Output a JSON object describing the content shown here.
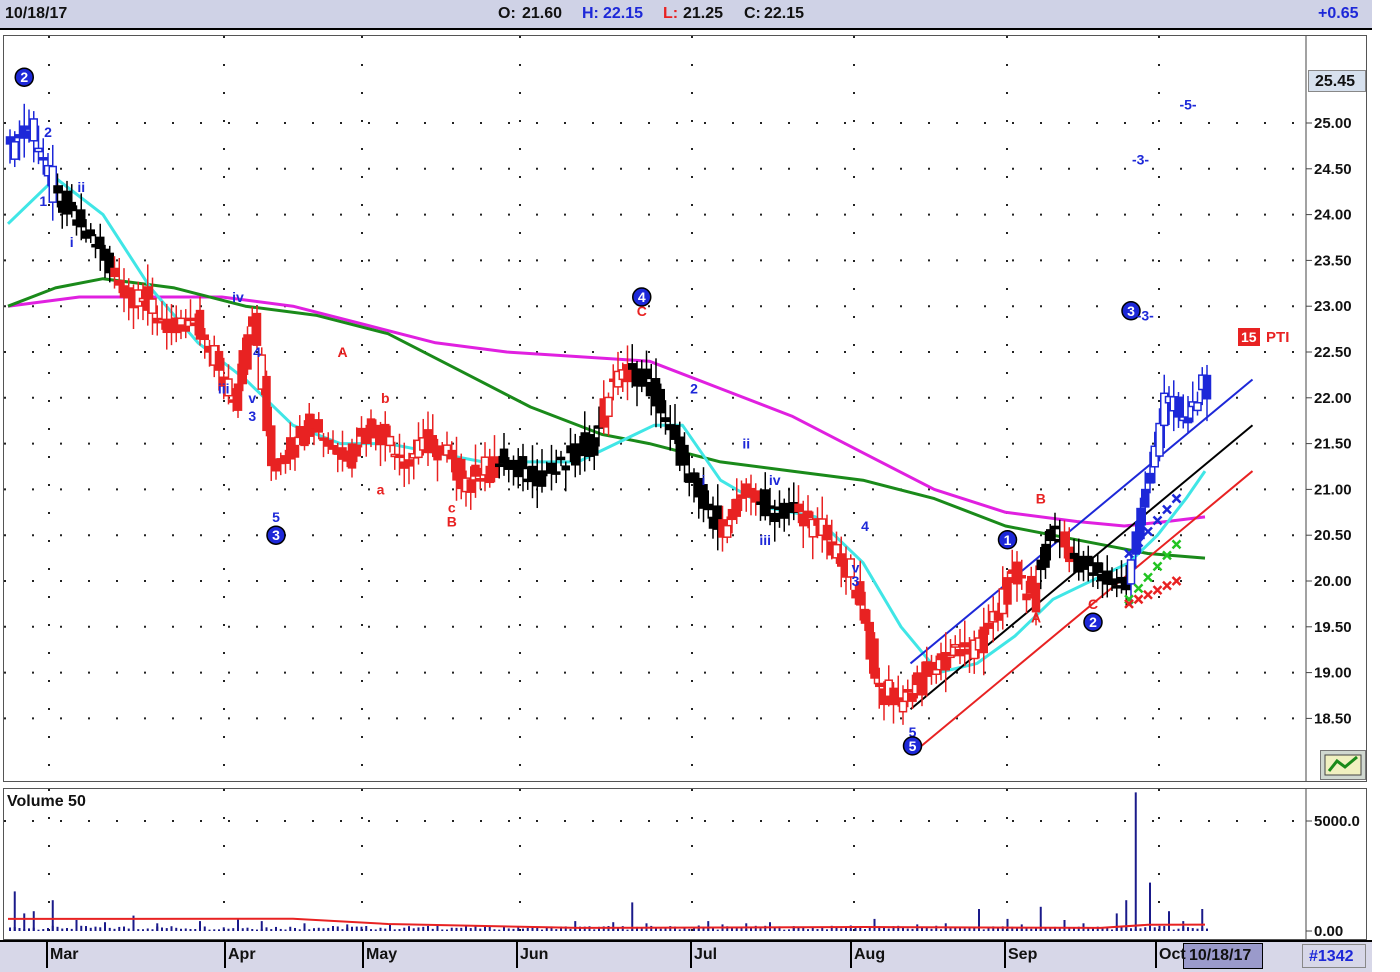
{
  "header": {
    "date": "10/18/17",
    "open_label": "O:",
    "open": "21.60",
    "high_label": "H:",
    "high": "22.15",
    "low_label": "L:",
    "low": "21.25",
    "close_label": "C:",
    "close": "22.15",
    "change": "+0.65"
  },
  "footer": {
    "date_box": "10/18/17",
    "id_box": "#1342",
    "months": [
      "Mar",
      "Apr",
      "May",
      "Jun",
      "Jul",
      "Aug",
      "Sep",
      "Oct"
    ]
  },
  "price_label": "25.45",
  "pti": {
    "value": "15",
    "label": "PTI"
  },
  "volume_label": "Volume 50",
  "colors": {
    "bull": "#e82222",
    "bear": "#000000",
    "blue": "#1d28d8",
    "cyan": "#40e6e6",
    "magenta": "#e020e0",
    "green": "#1a8a1a",
    "header_bg": "#cfd2e6"
  },
  "chart_data": {
    "type": "candlestick",
    "ylim": [
      18.0,
      26.0
    ],
    "y_ticks": [
      "18.50",
      "19.00",
      "19.50",
      "20.00",
      "20.50",
      "21.00",
      "21.50",
      "22.00",
      "22.50",
      "23.00",
      "23.50",
      "24.00",
      "24.50",
      "25.00"
    ],
    "x_ticks": [
      "Mar",
      "Apr",
      "May",
      "Jun",
      "Jul",
      "Aug",
      "Sep",
      "Oct"
    ],
    "price_path": [
      [
        0,
        24.7
      ],
      [
        5,
        25.0
      ],
      [
        10,
        24.2
      ],
      [
        15,
        23.9
      ],
      [
        20,
        23.6
      ],
      [
        25,
        23.2
      ],
      [
        30,
        23.0
      ],
      [
        35,
        22.7
      ],
      [
        40,
        22.8
      ],
      [
        45,
        22.3
      ],
      [
        48,
        22.0
      ],
      [
        52,
        22.9
      ],
      [
        56,
        21.3
      ],
      [
        60,
        21.5
      ],
      [
        64,
        21.8
      ],
      [
        68,
        21.5
      ],
      [
        72,
        21.4
      ],
      [
        76,
        21.7
      ],
      [
        80,
        21.6
      ],
      [
        84,
        21.3
      ],
      [
        88,
        21.5
      ],
      [
        92,
        21.4
      ],
      [
        96,
        21.1
      ],
      [
        100,
        21.2
      ],
      [
        104,
        21.3
      ],
      [
        108,
        21.2
      ],
      [
        112,
        21.2
      ],
      [
        116,
        21.2
      ],
      [
        120,
        21.4
      ],
      [
        124,
        21.6
      ],
      [
        128,
        22.2
      ],
      [
        132,
        22.3
      ],
      [
        136,
        22.1
      ],
      [
        140,
        21.6
      ],
      [
        144,
        21.1
      ],
      [
        148,
        20.7
      ],
      [
        152,
        20.6
      ],
      [
        156,
        21.0
      ],
      [
        160,
        20.8
      ],
      [
        164,
        20.8
      ],
      [
        168,
        20.7
      ],
      [
        172,
        20.5
      ],
      [
        176,
        20.2
      ],
      [
        180,
        19.7
      ],
      [
        184,
        18.8
      ],
      [
        188,
        18.7
      ],
      [
        192,
        18.9
      ],
      [
        196,
        19.1
      ],
      [
        200,
        19.3
      ],
      [
        204,
        19.2
      ],
      [
        208,
        19.6
      ],
      [
        212,
        20.1
      ],
      [
        216,
        19.8
      ],
      [
        220,
        20.6
      ],
      [
        224,
        20.3
      ],
      [
        228,
        20.1
      ],
      [
        232,
        20.0
      ],
      [
        236,
        20.0
      ],
      [
        240,
        21.0
      ],
      [
        244,
        22.0
      ],
      [
        248,
        21.7
      ],
      [
        252,
        22.15
      ]
    ],
    "ma_cyan": [
      [
        0,
        23.9
      ],
      [
        10,
        24.4
      ],
      [
        20,
        24.0
      ],
      [
        30,
        23.2
      ],
      [
        40,
        22.6
      ],
      [
        50,
        22.2
      ],
      [
        60,
        21.7
      ],
      [
        70,
        21.5
      ],
      [
        80,
        21.5
      ],
      [
        90,
        21.4
      ],
      [
        100,
        21.3
      ],
      [
        110,
        21.3
      ],
      [
        120,
        21.3
      ],
      [
        128,
        21.5
      ],
      [
        136,
        21.7
      ],
      [
        142,
        21.7
      ],
      [
        150,
        21.1
      ],
      [
        160,
        20.8
      ],
      [
        170,
        20.7
      ],
      [
        180,
        20.2
      ],
      [
        188,
        19.5
      ],
      [
        196,
        19.0
      ],
      [
        204,
        19.1
      ],
      [
        212,
        19.4
      ],
      [
        220,
        19.8
      ],
      [
        228,
        20.0
      ],
      [
        236,
        20.2
      ],
      [
        242,
        20.5
      ],
      [
        248,
        20.9
      ],
      [
        252,
        21.2
      ]
    ],
    "ma_magenta": [
      [
        0,
        23.0
      ],
      [
        15,
        23.1
      ],
      [
        30,
        23.1
      ],
      [
        45,
        23.1
      ],
      [
        60,
        23.0
      ],
      [
        75,
        22.8
      ],
      [
        90,
        22.6
      ],
      [
        105,
        22.5
      ],
      [
        120,
        22.45
      ],
      [
        135,
        22.4
      ],
      [
        150,
        22.1
      ],
      [
        165,
        21.8
      ],
      [
        180,
        21.4
      ],
      [
        195,
        21.0
      ],
      [
        210,
        20.75
      ],
      [
        225,
        20.65
      ],
      [
        235,
        20.6
      ],
      [
        244,
        20.65
      ],
      [
        252,
        20.7
      ]
    ],
    "ma_green": [
      [
        0,
        23.0
      ],
      [
        10,
        23.2
      ],
      [
        20,
        23.3
      ],
      [
        35,
        23.2
      ],
      [
        50,
        23.0
      ],
      [
        65,
        22.9
      ],
      [
        80,
        22.7
      ],
      [
        95,
        22.3
      ],
      [
        110,
        21.9
      ],
      [
        125,
        21.6
      ],
      [
        135,
        21.5
      ],
      [
        150,
        21.3
      ],
      [
        165,
        21.2
      ],
      [
        180,
        21.1
      ],
      [
        195,
        20.9
      ],
      [
        210,
        20.6
      ],
      [
        225,
        20.45
      ],
      [
        240,
        20.3
      ],
      [
        252,
        20.25
      ]
    ],
    "channel_blue": [
      [
        190,
        19.1
      ],
      [
        262,
        22.2
      ]
    ],
    "channel_black": [
      [
        190,
        18.6
      ],
      [
        262,
        21.7
      ]
    ],
    "channel_red": [
      [
        190,
        18.1
      ],
      [
        262,
        21.2
      ]
    ],
    "wave_labels": [
      {
        "text": "2",
        "i": 3,
        "y": 25.5,
        "c": "blue",
        "circle": true
      },
      {
        "text": "2",
        "i": 8,
        "y": 24.9,
        "c": "blue"
      },
      {
        "text": "1",
        "i": 7,
        "y": 24.15,
        "c": "blue"
      },
      {
        "text": "ii",
        "i": 15,
        "y": 24.3,
        "c": "blue"
      },
      {
        "text": "i",
        "i": 13,
        "y": 23.7,
        "c": "blue"
      },
      {
        "text": "iv",
        "i": 48,
        "y": 23.1,
        "c": "blue"
      },
      {
        "text": "iii",
        "i": 45,
        "y": 22.1,
        "c": "blue"
      },
      {
        "text": "4",
        "i": 52,
        "y": 22.5,
        "c": "blue"
      },
      {
        "text": "v",
        "i": 51,
        "y": 22.0,
        "c": "blue"
      },
      {
        "text": "3",
        "i": 51,
        "y": 21.8,
        "c": "blue"
      },
      {
        "text": "5",
        "i": 56,
        "y": 20.7,
        "c": "blue"
      },
      {
        "text": "3",
        "i": 56,
        "y": 20.5,
        "c": "blue",
        "circle": true
      },
      {
        "text": "A",
        "i": 70,
        "y": 22.5,
        "c": "red"
      },
      {
        "text": "b",
        "i": 79,
        "y": 22.0,
        "c": "red"
      },
      {
        "text": "a",
        "i": 78,
        "y": 21.0,
        "c": "red"
      },
      {
        "text": "c",
        "i": 93,
        "y": 20.8,
        "c": "red"
      },
      {
        "text": "B",
        "i": 93,
        "y": 20.65,
        "c": "red"
      },
      {
        "text": "4",
        "i": 133,
        "y": 23.1,
        "c": "blue",
        "circle": true
      },
      {
        "text": "C",
        "i": 133,
        "y": 22.95,
        "c": "red"
      },
      {
        "text": "2",
        "i": 144,
        "y": 22.1,
        "c": "blue"
      },
      {
        "text": "ii",
        "i": 155,
        "y": 21.5,
        "c": "blue"
      },
      {
        "text": "i",
        "i": 146,
        "y": 21.1,
        "c": "blue"
      },
      {
        "text": "iv",
        "i": 161,
        "y": 21.1,
        "c": "blue"
      },
      {
        "text": "iii",
        "i": 159,
        "y": 20.45,
        "c": "blue"
      },
      {
        "text": "4",
        "i": 180,
        "y": 20.6,
        "c": "blue"
      },
      {
        "text": "v",
        "i": 178,
        "y": 20.15,
        "c": "blue"
      },
      {
        "text": "3",
        "i": 178,
        "y": 20.0,
        "c": "blue"
      },
      {
        "text": "5",
        "i": 190,
        "y": 18.35,
        "c": "blue"
      },
      {
        "text": "5",
        "i": 190,
        "y": 18.2,
        "c": "blue",
        "circle": true
      },
      {
        "text": "1",
        "i": 210,
        "y": 20.45,
        "c": "blue",
        "circle": true
      },
      {
        "text": "B",
        "i": 217,
        "y": 20.9,
        "c": "red"
      },
      {
        "text": "A",
        "i": 216,
        "y": 19.6,
        "c": "red"
      },
      {
        "text": "C",
        "i": 228,
        "y": 19.75,
        "c": "red"
      },
      {
        "text": "2",
        "i": 228,
        "y": 19.55,
        "c": "blue",
        "circle": true
      },
      {
        "text": "3",
        "i": 236,
        "y": 22.95,
        "c": "blue",
        "circle": true
      },
      {
        "text": "-3-",
        "i": 238,
        "y": 24.6,
        "c": "blue"
      },
      {
        "text": "-5-",
        "i": 248,
        "y": 25.2,
        "c": "blue"
      },
      {
        "text": "-3-",
        "i": 239,
        "y": 22.9,
        "c": "blue"
      }
    ],
    "targets": [
      {
        "c": "blue",
        "from": [
          236,
          20.3
        ],
        "to": [
          246,
          20.9
        ]
      },
      {
        "c": "green",
        "from": [
          236,
          19.8
        ],
        "to": [
          246,
          20.4
        ]
      },
      {
        "c": "red",
        "from": [
          236,
          19.75
        ],
        "to": [
          246,
          20.0
        ]
      }
    ]
  },
  "volume_data": {
    "ylim": [
      0,
      6000
    ],
    "y_ticks": [
      "0.00",
      "5000.0"
    ],
    "ma_level": 200,
    "spikes": [
      [
        1,
        1800
      ],
      [
        3,
        800
      ],
      [
        5,
        900
      ],
      [
        9,
        1400
      ],
      [
        14,
        500
      ],
      [
        20,
        400
      ],
      [
        26,
        700
      ],
      [
        31,
        350
      ],
      [
        40,
        450
      ],
      [
        48,
        550
      ],
      [
        53,
        450
      ],
      [
        62,
        350
      ],
      [
        71,
        300
      ],
      [
        80,
        300
      ],
      [
        90,
        250
      ],
      [
        100,
        200
      ],
      [
        110,
        200
      ],
      [
        119,
        450
      ],
      [
        127,
        400
      ],
      [
        131,
        1300
      ],
      [
        134,
        350
      ],
      [
        140,
        200
      ],
      [
        145,
        250
      ],
      [
        147,
        450
      ],
      [
        150,
        300
      ],
      [
        155,
        350
      ],
      [
        160,
        400
      ],
      [
        165,
        200
      ],
      [
        177,
        250
      ],
      [
        182,
        550
      ],
      [
        191,
        300
      ],
      [
        197,
        350
      ],
      [
        204,
        1000
      ],
      [
        210,
        550
      ],
      [
        213,
        300
      ],
      [
        217,
        1100
      ],
      [
        222,
        500
      ],
      [
        226,
        350
      ],
      [
        233,
        800
      ],
      [
        235,
        1400
      ],
      [
        237,
        6300
      ],
      [
        240,
        2200
      ],
      [
        244,
        900
      ],
      [
        247,
        450
      ],
      [
        251,
        1000
      ]
    ]
  }
}
